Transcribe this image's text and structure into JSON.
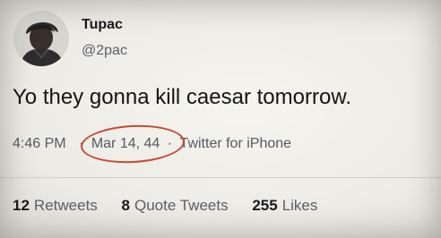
{
  "author": {
    "display_name": "Tupac",
    "handle": "@2pac"
  },
  "tweet": {
    "text": "Yo they gonna kill caesar tomorrow.",
    "time": "4:46 PM",
    "separator": "·",
    "date": "Mar 14, 44",
    "source": "Twitter for iPhone"
  },
  "stats": {
    "retweets": {
      "count": "12",
      "label": "Retweets"
    },
    "quote_tweets": {
      "count": "8",
      "label": "Quote Tweets"
    },
    "likes": {
      "count": "255",
      "label": "Likes"
    }
  },
  "colors": {
    "annotation_circle": "#c74a33",
    "background": "#efeee9"
  }
}
